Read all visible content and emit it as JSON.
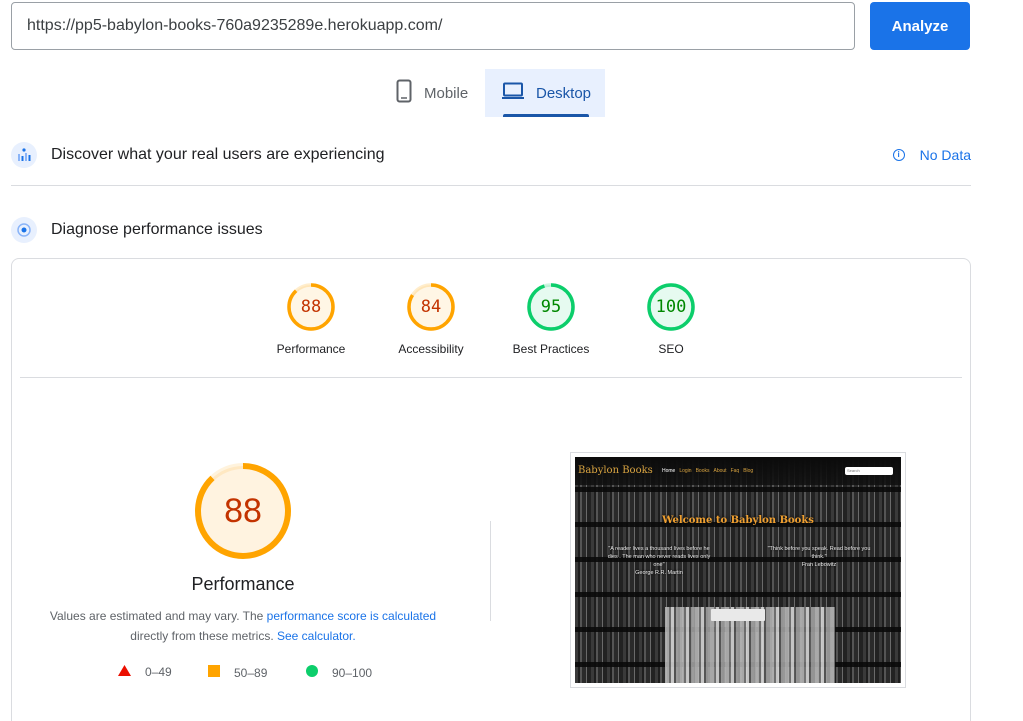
{
  "search": {
    "url_value": "https://pp5-babylon-books-760a9235289e.herokuapp.com/",
    "analyze_label": "Analyze"
  },
  "tabs": {
    "mobile": {
      "label": "Mobile",
      "icon": "phone-icon"
    },
    "desktop": {
      "label": "Desktop",
      "icon": "laptop-icon",
      "selected": true
    }
  },
  "sections": {
    "real_users": {
      "title": "Discover what your real users are experiencing",
      "icon": "crux-icon",
      "status_label": "No Data"
    },
    "diagnose": {
      "title": "Diagnose performance issues",
      "icon": "lighthouse-icon"
    }
  },
  "scores": [
    {
      "label": "Performance",
      "value": "88",
      "fraction": 0.88,
      "color": "#ffa400",
      "text_color": "#c33300"
    },
    {
      "label": "Accessibility",
      "value": "84",
      "fraction": 0.84,
      "color": "#ffa400",
      "text_color": "#c33300"
    },
    {
      "label": "Best Practices",
      "value": "95",
      "fraction": 0.95,
      "color": "#0cce6b",
      "text_color": "#008800"
    },
    {
      "label": "SEO",
      "value": "100",
      "fraction": 1.0,
      "color": "#0cce6b",
      "text_color": "#008800"
    }
  ],
  "performance": {
    "score": "88",
    "fraction": 0.88,
    "title": "Performance",
    "note_prefix": "Values are estimated and may vary. The ",
    "note_link1": "performance score is calculated",
    "note_middle": " directly from these metrics. ",
    "note_link2": "See calculator.",
    "color_ring": "#ffa400",
    "color_fill": "#fff3e0"
  },
  "legend": [
    {
      "range": "0–49",
      "shape": "triangle",
      "color": "#ff4e42"
    },
    {
      "range": "50–89",
      "shape": "square",
      "color": "#ffa400"
    },
    {
      "range": "90–100",
      "shape": "circle",
      "color": "#0cce6b"
    }
  ],
  "screenshot": {
    "brand": "Babylon Books",
    "nav_links": [
      "Home",
      "Login",
      "Books",
      "About",
      "Faq",
      "Blog"
    ],
    "search_placeholder": "Search",
    "heading": "Welcome to Babylon Books",
    "quote1": "\"A reader lives a thousand lives before he dies . The man who never reads lives only one\"",
    "quote1_author": "George R.R. Martin",
    "quote2": "\"Think before you speak. Read before you think.\"",
    "quote2_author": "Fran Lebowitz"
  }
}
